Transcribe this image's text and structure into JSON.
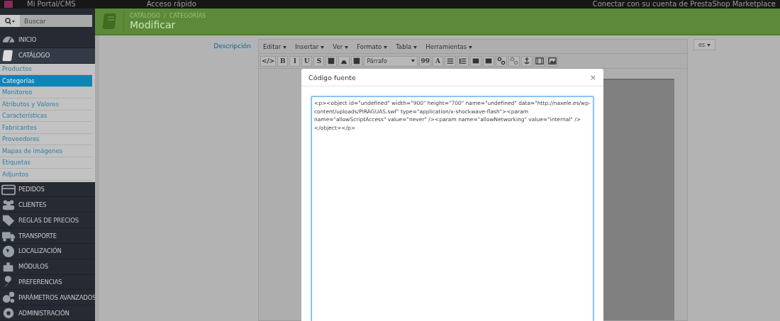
{
  "top_bar": {
    "brand": "Mi Portal/CMS",
    "quick_access": "Acceso rápido",
    "marketplace_link": "Conectar con su cuenta de PrestaShop Marketplace"
  },
  "sidebar": {
    "search": {
      "placeholder": "Buscar"
    },
    "items": [
      {
        "label": "INICIO",
        "expanded": false
      },
      {
        "label": "CATÁLOGO",
        "expanded": true,
        "children": [
          {
            "label": "Productos",
            "selected": false
          },
          {
            "label": "Categorías",
            "selected": true
          },
          {
            "label": "Monitoreo",
            "selected": false
          },
          {
            "label": "Atributos y Valores",
            "selected": false
          },
          {
            "label": "Características",
            "selected": false
          },
          {
            "label": "Fabricantes",
            "selected": false
          },
          {
            "label": "Proveedores",
            "selected": false
          },
          {
            "label": "Mapas de imágenes",
            "selected": false
          },
          {
            "label": "Etiquetas",
            "selected": false
          },
          {
            "label": "Adjuntos",
            "selected": false
          }
        ]
      },
      {
        "label": "PEDIDOS",
        "expanded": false
      },
      {
        "label": "CLIENTES",
        "expanded": false
      },
      {
        "label": "REGLAS DE PRECIOS",
        "expanded": false
      },
      {
        "label": "TRANSPORTE",
        "expanded": false
      },
      {
        "label": "LOCALIZACIÓN",
        "expanded": false
      },
      {
        "label": "MÓDULOS",
        "expanded": false
      },
      {
        "label": "PREFERENCIAS",
        "expanded": false
      },
      {
        "label": "PARÁMETROS AVANZADOS",
        "expanded": false
      },
      {
        "label": "ADMINISTRACIÓN",
        "expanded": false
      }
    ]
  },
  "header": {
    "breadcrumbs": [
      "CATÁLOGO",
      "CATEGORÍAS"
    ],
    "separator": "/",
    "title": "Modificar"
  },
  "form": {
    "field_label": "Descripción",
    "language": "es",
    "editor_menu": [
      "Editar",
      "Insertar",
      "Ver",
      "Formato",
      "Tabla",
      "Herramientas"
    ],
    "toolbar": [
      {
        "kind": "text",
        "label": "</>"
      },
      {
        "kind": "text",
        "label": "B"
      },
      {
        "kind": "text",
        "label": "I"
      },
      {
        "kind": "text",
        "label": "U"
      },
      {
        "kind": "text",
        "label": "S"
      },
      {
        "kind": "icon"
      },
      {
        "kind": "icon"
      },
      {
        "kind": "icon"
      },
      {
        "kind": "select",
        "label": "Párrafo"
      },
      {
        "kind": "text",
        "label": "99"
      },
      {
        "kind": "text",
        "label": "A"
      },
      {
        "kind": "icon"
      },
      {
        "kind": "icon"
      },
      {
        "kind": "icon"
      },
      {
        "kind": "icon"
      },
      {
        "kind": "icon"
      },
      {
        "kind": "icon"
      },
      {
        "kind": "icon"
      },
      {
        "kind": "icon"
      },
      {
        "kind": "icon"
      }
    ]
  },
  "dialog": {
    "title": "Código fuente",
    "close": "×",
    "source": "<p><object id=\"undefined\" width=\"900\" height=\"700\" name=\"undefined\" data=\"http://naxele.es/wp-content/uploads/PIRAGUAS.swf\" type=\"application/x-shockwave-flash\"><param name=\"allowScriptAccess\" value=\"never\" /><param name=\"allowNetworking\" value=\"internal\" /></object></p>"
  }
}
